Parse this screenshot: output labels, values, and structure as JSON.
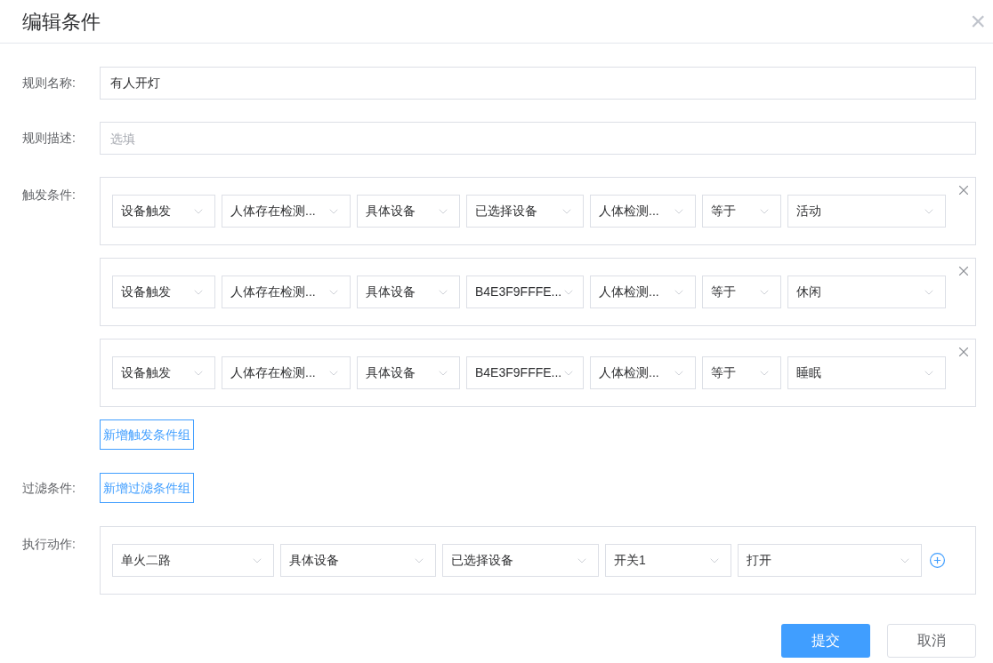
{
  "dialog": {
    "title": "编辑条件",
    "close_symbol": "×"
  },
  "rule_name": {
    "label": "规则名称:",
    "value": "有人开灯"
  },
  "rule_desc": {
    "label": "规则描述:",
    "placeholder": "选填"
  },
  "triggers": {
    "label": "触发条件:",
    "groups": [
      {
        "selects": [
          "设备触发",
          "人体存在检测...",
          "具体设备",
          "已选择设备",
          "人体检测...",
          "等于",
          "活动"
        ]
      },
      {
        "selects": [
          "设备触发",
          "人体存在检测...",
          "具体设备",
          "B4E3F9FFFE...",
          "人体检测...",
          "等于",
          "休闲"
        ]
      },
      {
        "selects": [
          "设备触发",
          "人体存在检测...",
          "具体设备",
          "B4E3F9FFFE...",
          "人体检测...",
          "等于",
          "睡眠"
        ]
      }
    ],
    "add_button": "新增触发条件组"
  },
  "filters": {
    "label": "过滤条件:",
    "add_button": "新增过滤条件组"
  },
  "actions": {
    "label": "执行动作:",
    "selects": [
      "单火二路",
      "具体设备",
      "已选择设备",
      "开关1",
      "打开"
    ]
  },
  "footer": {
    "submit": "提交",
    "cancel": "取消"
  }
}
